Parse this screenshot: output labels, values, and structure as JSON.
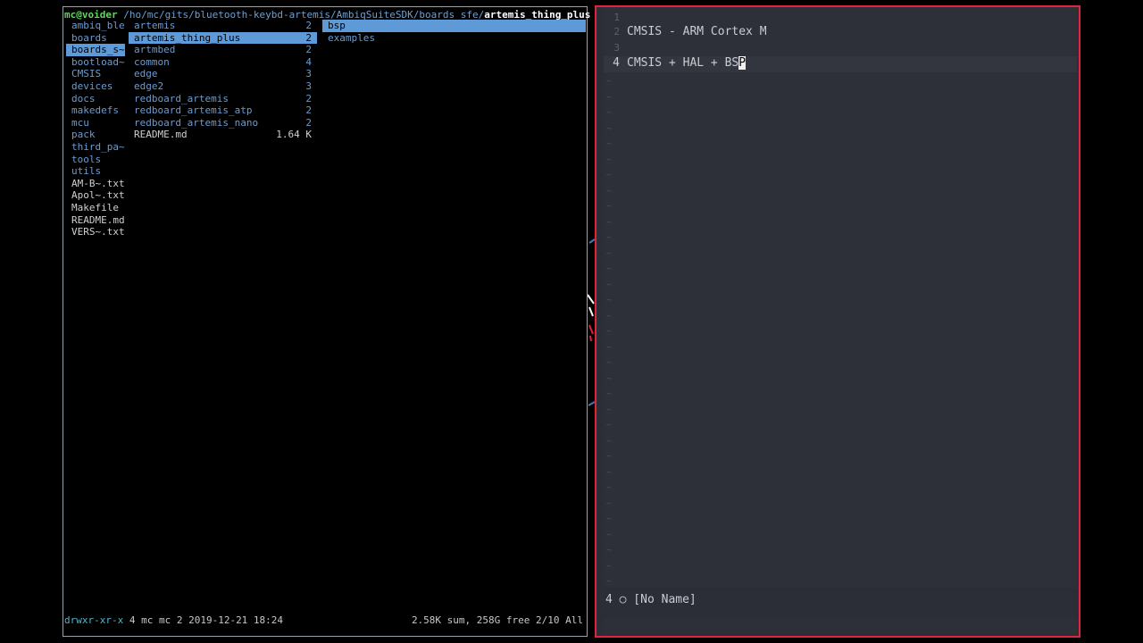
{
  "terminal": {
    "prompt_user": "mc@voider",
    "prompt_path": " /ho/mc/gits/bluetooth-keybd-artemis/AmbiqSuiteSDK/boards_sfe/",
    "prompt_current": "artemis_thing_plus",
    "parent_column": [
      {
        "name": "ambiq_ble",
        "type": "dir"
      },
      {
        "name": "boards",
        "type": "dir"
      },
      {
        "name": "boards_s~",
        "type": "dir",
        "selected": true
      },
      {
        "name": "bootload~",
        "type": "dir"
      },
      {
        "name": "CMSIS",
        "type": "dir"
      },
      {
        "name": "devices",
        "type": "dir"
      },
      {
        "name": "docs",
        "type": "dir"
      },
      {
        "name": "makedefs",
        "type": "dir"
      },
      {
        "name": "mcu",
        "type": "dir"
      },
      {
        "name": "pack",
        "type": "dir"
      },
      {
        "name": "third_pa~",
        "type": "dir"
      },
      {
        "name": "tools",
        "type": "dir"
      },
      {
        "name": "utils",
        "type": "dir"
      },
      {
        "name": "AM-B~.txt",
        "type": "file"
      },
      {
        "name": "Apol~.txt",
        "type": "file"
      },
      {
        "name": "Makefile",
        "type": "file"
      },
      {
        "name": "README.md",
        "type": "file"
      },
      {
        "name": "VERS~.txt",
        "type": "file"
      }
    ],
    "current_column": [
      {
        "name": "artemis",
        "count": "2",
        "type": "dir"
      },
      {
        "name": "artemis_thing_plus",
        "count": "2",
        "type": "dir",
        "selected": true
      },
      {
        "name": "artmbed",
        "count": "2",
        "type": "dir"
      },
      {
        "name": "common",
        "count": "4",
        "type": "dir"
      },
      {
        "name": "edge",
        "count": "3",
        "type": "dir"
      },
      {
        "name": "edge2",
        "count": "3",
        "type": "dir"
      },
      {
        "name": "redboard_artemis",
        "count": "2",
        "type": "dir"
      },
      {
        "name": "redboard_artemis_atp",
        "count": "2",
        "type": "dir"
      },
      {
        "name": "redboard_artemis_nano",
        "count": "2",
        "type": "dir"
      },
      {
        "name": "README.md",
        "count": "1.64 K",
        "type": "file"
      }
    ],
    "preview_column": [
      {
        "name": "bsp",
        "type": "dir",
        "selected": true
      },
      {
        "name": "examples",
        "type": "dir"
      }
    ],
    "status_perm": "drwxr-xr-x",
    "status_info": " 4 mc mc 2 2019-12-21 18:24",
    "status_right": "2.58K sum, 258G free  2/10  All"
  },
  "editor": {
    "lines": [
      {
        "num": "1",
        "text": ""
      },
      {
        "num": "2",
        "text": "CMSIS - ARM Cortex M"
      },
      {
        "num": "3",
        "text": ""
      },
      {
        "num": "4",
        "text": "CMSIS + HAL + BS",
        "cursor_char": "P"
      }
    ],
    "status_line": "4 ○ [No Name]",
    "tilde": "~"
  },
  "colors": {
    "selection": "#5f9ad8",
    "directory": "#6c9bd2",
    "prompt_user": "#5fd75f",
    "editor_border": "#e0243c",
    "editor_bg": "#2e3039"
  }
}
